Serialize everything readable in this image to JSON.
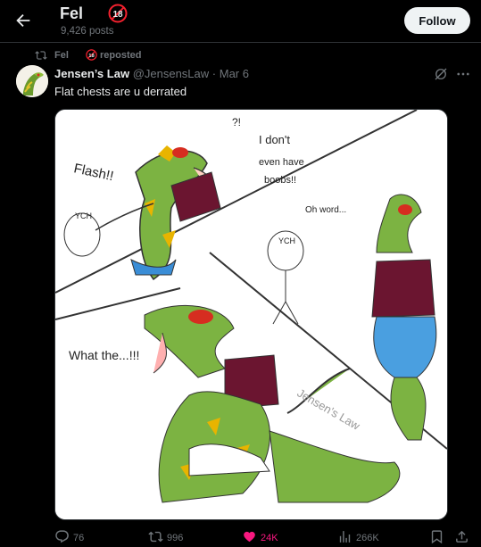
{
  "header": {
    "title": "Fel",
    "posts_count": "9,426 posts",
    "follow_label": "Follow",
    "badge_text": "18"
  },
  "repost": {
    "name": "Fel",
    "label": "reposted",
    "badge_text": "18"
  },
  "post": {
    "author": "Jensen’s Law",
    "handle": "@JensensLaw",
    "separator": "·",
    "date": "Mar 6",
    "text": "Flat chests are u derrated"
  },
  "comic": {
    "texts": [
      "?!",
      "Flash!!",
      "I don't",
      "even have",
      "boobs!!",
      "YCH",
      "Oh word...",
      "YCH",
      "What the...!!!",
      "Jensen's Law"
    ]
  },
  "actions": {
    "replies": "76",
    "reposts": "996",
    "likes": "24K",
    "views": "266K"
  },
  "colors": {
    "accent_like": "#f91880",
    "muted": "#71767b",
    "badge_red": "#f4212e"
  }
}
